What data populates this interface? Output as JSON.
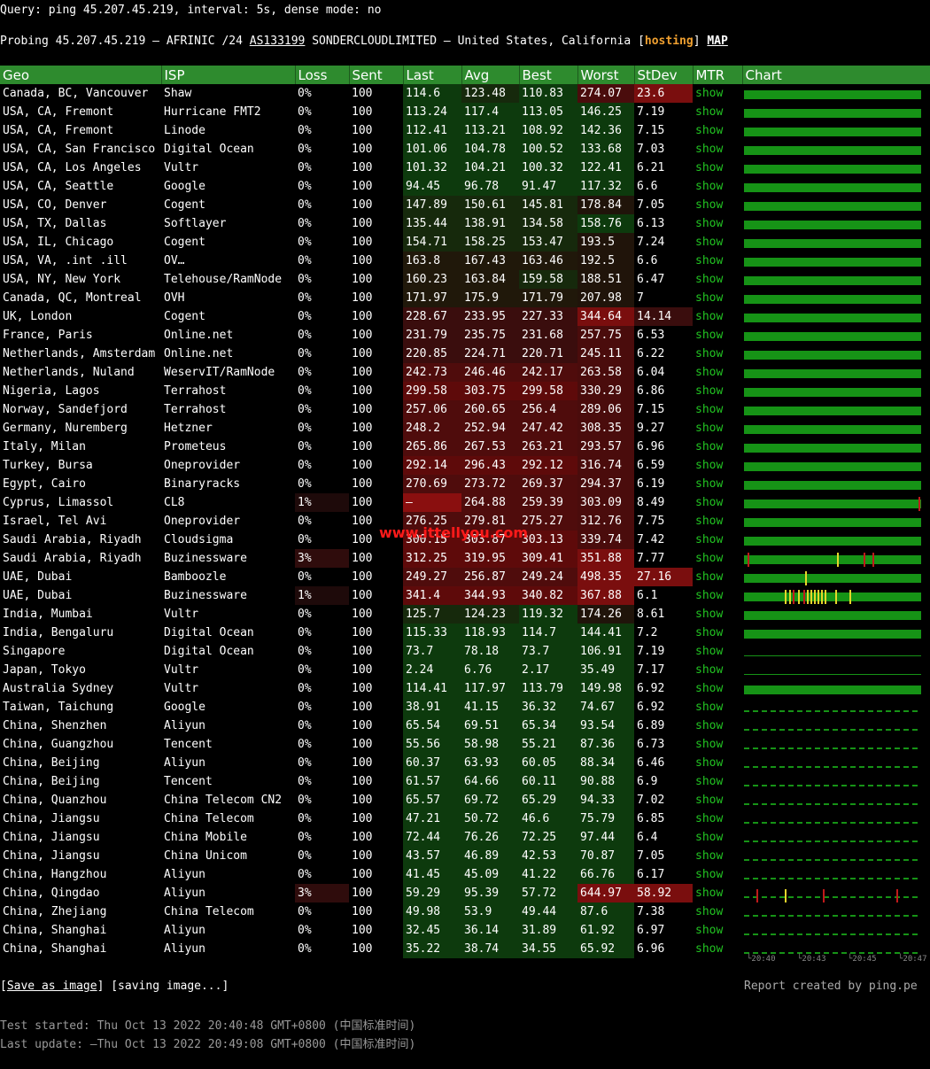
{
  "query_text": "Query: ping 45.207.45.219, interval: 5s, dense mode: no",
  "probe": {
    "prefix": "Probing 45.207.45.219 — AFRINIC /24 ",
    "asn": "AS133199",
    "mid": " SONDERCLOUDLIMITED — United States, California [",
    "tag": "hosting",
    "close": "] ",
    "map": "MAP"
  },
  "headers": [
    "Geo",
    "ISP",
    "Loss",
    "Sent",
    "Last",
    "Avg",
    "Best",
    "Worst",
    "StDev",
    "MTR",
    "Chart"
  ],
  "colors": {
    "header_bg": "#2e8b2e",
    "bar": "#169316",
    "show": "#22c322",
    "tag": "#f0a030",
    "spike_red": "#c01a1a",
    "spike_yellow": "#e6d62a"
  },
  "rows": [
    {
      "geo": "Canada, BC, Vancouver",
      "isp": "Shaw",
      "loss": "0%",
      "sent": "100",
      "last": "114.6",
      "avg": "123.48",
      "best": "110.83",
      "worst": "274.07",
      "stdev": "23.6",
      "mtr": "show",
      "chart": "bar",
      "spikes": []
    },
    {
      "geo": "USA, CA, Fremont",
      "isp": "Hurricane FMT2",
      "loss": "0%",
      "sent": "100",
      "last": "113.24",
      "avg": "117.4",
      "best": "113.05",
      "worst": "146.25",
      "stdev": "7.19",
      "mtr": "show",
      "chart": "bar",
      "spikes": []
    },
    {
      "geo": "USA, CA, Fremont",
      "isp": "Linode",
      "loss": "0%",
      "sent": "100",
      "last": "112.41",
      "avg": "113.21",
      "best": "108.92",
      "worst": "142.36",
      "stdev": "7.15",
      "mtr": "show",
      "chart": "bar",
      "spikes": []
    },
    {
      "geo": "USA, CA, San Francisco",
      "isp": "Digital Ocean",
      "loss": "0%",
      "sent": "100",
      "last": "101.06",
      "avg": "104.78",
      "best": "100.52",
      "worst": "133.68",
      "stdev": "7.03",
      "mtr": "show",
      "chart": "bar",
      "spikes": []
    },
    {
      "geo": "USA, CA, Los Angeles",
      "isp": "Vultr",
      "loss": "0%",
      "sent": "100",
      "last": "101.32",
      "avg": "104.21",
      "best": "100.32",
      "worst": "122.41",
      "stdev": "6.21",
      "mtr": "show",
      "chart": "bar",
      "spikes": []
    },
    {
      "geo": "USA, CA, Seattle",
      "isp": "Google",
      "loss": "0%",
      "sent": "100",
      "last": "94.45",
      "avg": "96.78",
      "best": "91.47",
      "worst": "117.32",
      "stdev": "6.6",
      "mtr": "show",
      "chart": "bar",
      "spikes": []
    },
    {
      "geo": "USA, CO, Denver",
      "isp": "Cogent",
      "loss": "0%",
      "sent": "100",
      "last": "147.89",
      "avg": "150.61",
      "best": "145.81",
      "worst": "178.84",
      "stdev": "7.05",
      "mtr": "show",
      "chart": "bar",
      "spikes": []
    },
    {
      "geo": "USA, TX, Dallas",
      "isp": "Softlayer",
      "loss": "0%",
      "sent": "100",
      "last": "135.44",
      "avg": "138.91",
      "best": "134.58",
      "worst": "158.76",
      "stdev": "6.13",
      "mtr": "show",
      "chart": "bar",
      "spikes": []
    },
    {
      "geo": "USA, IL, Chicago",
      "isp": "Cogent",
      "loss": "0%",
      "sent": "100",
      "last": "154.71",
      "avg": "158.25",
      "best": "153.47",
      "worst": "193.5",
      "stdev": "7.24",
      "mtr": "show",
      "chart": "bar",
      "spikes": []
    },
    {
      "geo": "USA, VA, .int .ill",
      "isp": "OV…",
      "loss": "0%",
      "sent": "100",
      "last": "163.8",
      "avg": "167.43",
      "best": "163.46",
      "worst": "192.5",
      "stdev": "6.6",
      "mtr": "show",
      "chart": "bar",
      "spikes": []
    },
    {
      "geo": "USA, NY, New York",
      "isp": "Telehouse/RamNode",
      "loss": "0%",
      "sent": "100",
      "last": "160.23",
      "avg": "163.84",
      "best": "159.58",
      "worst": "188.51",
      "stdev": "6.47",
      "mtr": "show",
      "chart": "bar",
      "spikes": []
    },
    {
      "geo": "Canada, QC, Montreal",
      "isp": "OVH",
      "loss": "0%",
      "sent": "100",
      "last": "171.97",
      "avg": "175.9",
      "best": "171.79",
      "worst": "207.98",
      "stdev": "7",
      "mtr": "show",
      "chart": "bar",
      "spikes": []
    },
    {
      "geo": "UK, London",
      "isp": "Cogent",
      "loss": "0%",
      "sent": "100",
      "last": "228.67",
      "avg": "233.95",
      "best": "227.33",
      "worst": "344.64",
      "stdev": "14.14",
      "mtr": "show",
      "chart": "bar",
      "spikes": []
    },
    {
      "geo": "France, Paris",
      "isp": "Online.net",
      "loss": "0%",
      "sent": "100",
      "last": "231.79",
      "avg": "235.75",
      "best": "231.68",
      "worst": "257.75",
      "stdev": "6.53",
      "mtr": "show",
      "chart": "bar",
      "spikes": []
    },
    {
      "geo": "Netherlands, Amsterdam",
      "isp": "Online.net",
      "loss": "0%",
      "sent": "100",
      "last": "220.85",
      "avg": "224.71",
      "best": "220.71",
      "worst": "245.11",
      "stdev": "6.22",
      "mtr": "show",
      "chart": "bar",
      "spikes": []
    },
    {
      "geo": "Netherlands, Nuland",
      "isp": "WeservIT/RamNode",
      "loss": "0%",
      "sent": "100",
      "last": "242.73",
      "avg": "246.46",
      "best": "242.17",
      "worst": "263.58",
      "stdev": "6.04",
      "mtr": "show",
      "chart": "bar",
      "spikes": []
    },
    {
      "geo": "Nigeria, Lagos",
      "isp": "Terrahost",
      "loss": "0%",
      "sent": "100",
      "last": "299.58",
      "avg": "303.75",
      "best": "299.58",
      "worst": "330.29",
      "stdev": "6.86",
      "mtr": "show",
      "chart": "bar",
      "spikes": []
    },
    {
      "geo": "Norway, Sandefjord",
      "isp": "Terrahost",
      "loss": "0%",
      "sent": "100",
      "last": "257.06",
      "avg": "260.65",
      "best": "256.4",
      "worst": "289.06",
      "stdev": "7.15",
      "mtr": "show",
      "chart": "bar",
      "spikes": []
    },
    {
      "geo": "Germany, Nuremberg",
      "isp": "Hetzner",
      "loss": "0%",
      "sent": "100",
      "last": "248.2",
      "avg": "252.94",
      "best": "247.42",
      "worst": "308.35",
      "stdev": "9.27",
      "mtr": "show",
      "chart": "bar",
      "spikes": []
    },
    {
      "geo": "Italy, Milan",
      "isp": "Prometeus",
      "loss": "0%",
      "sent": "100",
      "last": "265.86",
      "avg": "267.53",
      "best": "263.21",
      "worst": "293.57",
      "stdev": "6.96",
      "mtr": "show",
      "chart": "bar",
      "spikes": []
    },
    {
      "geo": "Turkey, Bursa",
      "isp": "Oneprovider",
      "loss": "0%",
      "sent": "100",
      "last": "292.14",
      "avg": "296.43",
      "best": "292.12",
      "worst": "316.74",
      "stdev": "6.59",
      "mtr": "show",
      "chart": "bar",
      "spikes": []
    },
    {
      "geo": "Egypt, Cairo",
      "isp": "Binaryracks",
      "loss": "0%",
      "sent": "100",
      "last": "270.69",
      "avg": "273.72",
      "best": "269.37",
      "worst": "294.37",
      "stdev": "6.19",
      "mtr": "show",
      "chart": "bar",
      "spikes": []
    },
    {
      "geo": "Cyprus, Limassol",
      "isp": "CL8",
      "loss": "1%",
      "sent": "100",
      "last": "–",
      "avg": "264.88",
      "best": "259.39",
      "worst": "303.09",
      "stdev": "8.49",
      "mtr": "show",
      "chart": "bar",
      "spikes": [
        {
          "pos": 0.995,
          "color": "red"
        }
      ]
    },
    {
      "geo": "Israel, Tel Avi",
      "isp": "Oneprovider",
      "loss": "0%",
      "sent": "100",
      "last": "276.25",
      "avg": "279.81",
      "best": "275.27",
      "worst": "312.76",
      "stdev": "7.75",
      "mtr": "show",
      "chart": "bar",
      "spikes": []
    },
    {
      "geo": "Saudi Arabia, Riyadh",
      "isp": "Cloudsigma",
      "loss": "0%",
      "sent": "100",
      "last": "300.15",
      "avg": "303.87",
      "best": "303.13",
      "worst": "339.74",
      "stdev": "7.42",
      "mtr": "show",
      "chart": "bar",
      "spikes": []
    },
    {
      "geo": "Saudi Arabia, Riyadh",
      "isp": "Buzinessware",
      "loss": "3%",
      "sent": "100",
      "last": "312.25",
      "avg": "319.95",
      "best": "309.41",
      "worst": "351.88",
      "stdev": "7.77",
      "mtr": "show",
      "chart": "bar",
      "spikes": [
        {
          "pos": 0.02,
          "color": "red"
        },
        {
          "pos": 0.53,
          "color": "yellow"
        },
        {
          "pos": 0.68,
          "color": "red"
        },
        {
          "pos": 0.73,
          "color": "red"
        }
      ]
    },
    {
      "geo": "UAE, Dubai",
      "isp": "Bamboozle",
      "loss": "0%",
      "sent": "100",
      "last": "249.27",
      "avg": "256.87",
      "best": "249.24",
      "worst": "498.35",
      "stdev": "27.16",
      "mtr": "show",
      "chart": "bar",
      "spikes": [
        {
          "pos": 0.35,
          "color": "yellow"
        }
      ]
    },
    {
      "geo": "UAE, Dubai",
      "isp": "Buzinessware",
      "loss": "1%",
      "sent": "100",
      "last": "341.4",
      "avg": "344.93",
      "best": "340.82",
      "worst": "367.88",
      "stdev": "6.1",
      "mtr": "show",
      "chart": "bar",
      "spikes": [
        {
          "pos": 0.23,
          "color": "yellow"
        },
        {
          "pos": 0.26,
          "color": "yellow"
        },
        {
          "pos": 0.28,
          "color": "red"
        },
        {
          "pos": 0.31,
          "color": "yellow"
        },
        {
          "pos": 0.34,
          "color": "red"
        },
        {
          "pos": 0.36,
          "color": "yellow"
        },
        {
          "pos": 0.38,
          "color": "yellow"
        },
        {
          "pos": 0.4,
          "color": "yellow"
        },
        {
          "pos": 0.42,
          "color": "yellow"
        },
        {
          "pos": 0.44,
          "color": "yellow"
        },
        {
          "pos": 0.46,
          "color": "yellow"
        },
        {
          "pos": 0.52,
          "color": "yellow"
        },
        {
          "pos": 0.6,
          "color": "yellow"
        }
      ]
    },
    {
      "geo": "India, Mumbai",
      "isp": "Vultr",
      "loss": "0%",
      "sent": "100",
      "last": "125.7",
      "avg": "124.23",
      "best": "119.32",
      "worst": "174.26",
      "stdev": "8.61",
      "mtr": "show",
      "chart": "bar",
      "spikes": []
    },
    {
      "geo": "India, Bengaluru",
      "isp": "Digital Ocean",
      "loss": "0%",
      "sent": "100",
      "last": "115.33",
      "avg": "118.93",
      "best": "114.7",
      "worst": "144.41",
      "stdev": "7.2",
      "mtr": "show",
      "chart": "bar",
      "spikes": []
    },
    {
      "geo": "Singapore",
      "isp": "Digital Ocean",
      "loss": "0%",
      "sent": "100",
      "last": "73.7",
      "avg": "78.18",
      "best": "73.7",
      "worst": "106.91",
      "stdev": "7.19",
      "mtr": "show",
      "chart": "thin",
      "spikes": []
    },
    {
      "geo": "Japan, Tokyo",
      "isp": "Vultr",
      "loss": "0%",
      "sent": "100",
      "last": "2.24",
      "avg": "6.76",
      "best": "2.17",
      "worst": "35.49",
      "stdev": "7.17",
      "mtr": "show",
      "chart": "thin",
      "spikes": []
    },
    {
      "geo": "Australia  Sydney",
      "isp": "Vultr",
      "loss": "0%",
      "sent": "100",
      "last": "114.41",
      "avg": "117.97",
      "best": "113.79",
      "worst": "149.98",
      "stdev": "6.92",
      "mtr": "show",
      "chart": "bar",
      "spikes": []
    },
    {
      "geo": "Taiwan, Taichung",
      "isp": "Google",
      "loss": "0%",
      "sent": "100",
      "last": "38.91",
      "avg": "41.15",
      "best": "36.32",
      "worst": "74.67",
      "stdev": "6.92",
      "mtr": "show",
      "chart": "dotted",
      "spikes": []
    },
    {
      "geo": "China, Shenzhen",
      "isp": "Aliyun",
      "loss": "0%",
      "sent": "100",
      "last": "65.54",
      "avg": "69.51",
      "best": "65.34",
      "worst": "93.54",
      "stdev": "6.89",
      "mtr": "show",
      "chart": "dotted",
      "spikes": []
    },
    {
      "geo": "China, Guangzhou",
      "isp": "Tencent",
      "loss": "0%",
      "sent": "100",
      "last": "55.56",
      "avg": "58.98",
      "best": "55.21",
      "worst": "87.36",
      "stdev": "6.73",
      "mtr": "show",
      "chart": "dotted",
      "spikes": []
    },
    {
      "geo": "China, Beijing",
      "isp": "Aliyun",
      "loss": "0%",
      "sent": "100",
      "last": "60.37",
      "avg": "63.93",
      "best": "60.05",
      "worst": "88.34",
      "stdev": "6.46",
      "mtr": "show",
      "chart": "dotted",
      "spikes": []
    },
    {
      "geo": "China, Beijing",
      "isp": "Tencent",
      "loss": "0%",
      "sent": "100",
      "last": "61.57",
      "avg": "64.66",
      "best": "60.11",
      "worst": "90.88",
      "stdev": "6.9",
      "mtr": "show",
      "chart": "dotted",
      "spikes": []
    },
    {
      "geo": "China, Quanzhou",
      "isp": "China Telecom CN2",
      "loss": "0%",
      "sent": "100",
      "last": "65.57",
      "avg": "69.72",
      "best": "65.29",
      "worst": "94.33",
      "stdev": "7.02",
      "mtr": "show",
      "chart": "dotted",
      "spikes": []
    },
    {
      "geo": "China, Jiangsu",
      "isp": "China Telecom",
      "loss": "0%",
      "sent": "100",
      "last": "47.21",
      "avg": "50.72",
      "best": "46.6",
      "worst": "75.79",
      "stdev": "6.85",
      "mtr": "show",
      "chart": "dotted",
      "spikes": []
    },
    {
      "geo": "China, Jiangsu",
      "isp": "China Mobile",
      "loss": "0%",
      "sent": "100",
      "last": "72.44",
      "avg": "76.26",
      "best": "72.25",
      "worst": "97.44",
      "stdev": "6.4",
      "mtr": "show",
      "chart": "dotted",
      "spikes": []
    },
    {
      "geo": "China, Jiangsu",
      "isp": "China Unicom",
      "loss": "0%",
      "sent": "100",
      "last": "43.57",
      "avg": "46.89",
      "best": "42.53",
      "worst": "70.87",
      "stdev": "7.05",
      "mtr": "show",
      "chart": "dotted",
      "spikes": []
    },
    {
      "geo": "China, Hangzhou",
      "isp": "Aliyun",
      "loss": "0%",
      "sent": "100",
      "last": "41.45",
      "avg": "45.09",
      "best": "41.22",
      "worst": "66.76",
      "stdev": "6.17",
      "mtr": "show",
      "chart": "dotted",
      "spikes": []
    },
    {
      "geo": "China, Qingdao",
      "isp": "Aliyun",
      "loss": "3%",
      "sent": "100",
      "last": "59.29",
      "avg": "95.39",
      "best": "57.72",
      "worst": "644.97",
      "stdev": "58.92",
      "mtr": "show",
      "chart": "dotted",
      "spikes": [
        {
          "pos": 0.07,
          "color": "red"
        },
        {
          "pos": 0.23,
          "color": "yellow"
        },
        {
          "pos": 0.45,
          "color": "red"
        },
        {
          "pos": 0.87,
          "color": "red"
        }
      ]
    },
    {
      "geo": "China, Zhejiang",
      "isp": "China Telecom",
      "loss": "0%",
      "sent": "100",
      "last": "49.98",
      "avg": "53.9",
      "best": "49.44",
      "worst": "87.6",
      "stdev": "7.38",
      "mtr": "show",
      "chart": "dotted",
      "spikes": []
    },
    {
      "geo": "China, Shanghai",
      "isp": "Aliyun",
      "loss": "0%",
      "sent": "100",
      "last": "32.45",
      "avg": "36.14",
      "best": "31.89",
      "worst": "61.92",
      "stdev": "6.97",
      "mtr": "show",
      "chart": "dotted",
      "spikes": []
    },
    {
      "geo": "China, Shanghai",
      "isp": "Aliyun",
      "loss": "0%",
      "sent": "100",
      "last": "35.22",
      "avg": "38.74",
      "best": "34.55",
      "worst": "65.92",
      "stdev": "6.96",
      "mtr": "show",
      "chart": "dotted",
      "spikes": []
    }
  ],
  "chart_axis": [
    "20:40",
    "20:43",
    "20:45",
    "20:47"
  ],
  "footer": {
    "save_prefix": "[",
    "save_label": "Save as image",
    "save_suffix": "] [saving image...]",
    "credit": "Report created by ping.pe",
    "started": "Test started: Thu Oct 13 2022 20:40:48 GMT+0800 (中国标准时间)",
    "updated": "Last update: —Thu Oct 13 2022 20:49:08 GMT+0800 (中国标准时间)"
  },
  "watermark": "www.ittellyou.com"
}
